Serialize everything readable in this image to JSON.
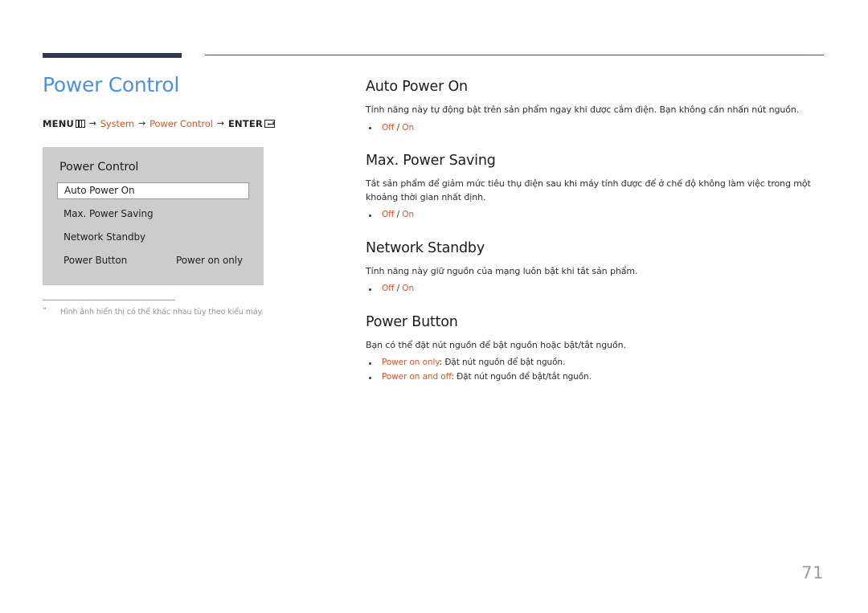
{
  "header": {
    "accent_bar_color": "#2e3754",
    "rule_color": "#4a4f68"
  },
  "page": {
    "title": "Power Control",
    "title_color": "#4a90e8",
    "number": "71"
  },
  "breadcrumb": {
    "menu_label": "MENU",
    "menu_icon": "menu-grid-icon",
    "arrow": "→",
    "step1": "System",
    "step2": "Power Control",
    "enter_label": "ENTER",
    "enter_icon": "enter-key-icon",
    "accent_color": "#e0522a"
  },
  "osd": {
    "title": "Power Control",
    "background": "#cccccc",
    "rows": [
      {
        "label": "Auto Power On",
        "value": "",
        "selected": true
      },
      {
        "label": "Max. Power Saving",
        "value": "",
        "selected": false
      },
      {
        "label": "Network Standby",
        "value": "",
        "selected": false
      },
      {
        "label": "Power Button",
        "value": "Power on only",
        "selected": false
      }
    ]
  },
  "footnote": {
    "marker": "ˮ",
    "text": "Hình ảnh hiển thị có thể khác nhau tùy theo kiểu máy."
  },
  "sections": [
    {
      "title": "Auto Power On",
      "desc": "Tính năng này tự động bật trên sản phẩm ngay khi được cắm điện. Bạn không cần nhấn nút nguồn.",
      "options": [
        {
          "accent": "Off",
          "sep": " / ",
          "accent2": "On",
          "rest": ""
        }
      ]
    },
    {
      "title": "Max. Power Saving",
      "desc": "Tắt sản phẩm để giảm mức tiêu thụ điện sau khi máy tính được để ở chế độ không làm việc trong một khoảng thời gian nhất định.",
      "options": [
        {
          "accent": "Off",
          "sep": " / ",
          "accent2": "On",
          "rest": ""
        }
      ]
    },
    {
      "title": "Network Standby",
      "desc": "Tính năng này giữ nguồn của mạng luôn bật khi tắt sản phẩm.",
      "options": [
        {
          "accent": "Off",
          "sep": " / ",
          "accent2": "On",
          "rest": ""
        }
      ]
    },
    {
      "title": "Power Button",
      "desc": "Bạn có thể đặt nút nguồn để bật nguồn hoặc bật/tắt nguồn.",
      "options": [
        {
          "accent": "Power on only",
          "sep": "",
          "accent2": "",
          "rest": ": Đặt nút nguồn để bật nguồn."
        },
        {
          "accent": "Power on and off",
          "sep": "",
          "accent2": "",
          "rest": ": Đặt nút nguồn để bật/tắt nguồn."
        }
      ]
    }
  ]
}
